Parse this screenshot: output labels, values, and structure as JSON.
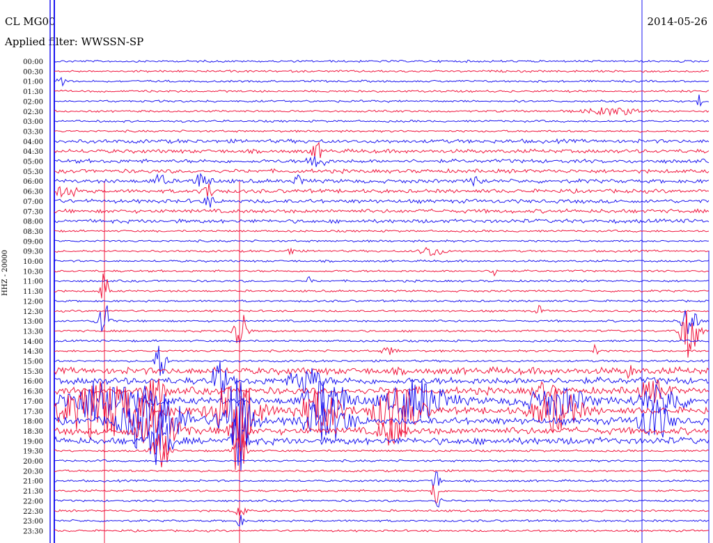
{
  "header": {
    "station": "CL MG00",
    "date": "2014-05-26",
    "filter": "Applied filter: WWSSN-SP"
  },
  "colors": {
    "trace_a": "#1a14f0",
    "trace_b": "#f0143c",
    "background": "#ffffff",
    "text": "#000000"
  },
  "chart_data": {
    "type": "line",
    "title": "",
    "ylabel": "HHZ - 20000",
    "xlabel": "",
    "row_labels": [
      "00:00",
      "00:30",
      "01:00",
      "01:30",
      "02:00",
      "02:30",
      "03:00",
      "03:30",
      "04:00",
      "04:30",
      "05:00",
      "05:30",
      "06:00",
      "06:30",
      "07:00",
      "07:30",
      "08:00",
      "08:30",
      "09:00",
      "09:30",
      "10:00",
      "10:30",
      "11:00",
      "11:30",
      "12:00",
      "12:30",
      "13:00",
      "13:30",
      "14:00",
      "14:30",
      "15:00",
      "15:30",
      "16:00",
      "16:30",
      "17:00",
      "17:30",
      "18:00",
      "18:30",
      "19:00",
      "19:30",
      "20:00",
      "20:30",
      "21:00",
      "21:30",
      "22:00",
      "22:30",
      "23:00",
      "23:30"
    ],
    "row_colors": [
      "blue",
      "red",
      "blue",
      "red",
      "blue",
      "red",
      "blue",
      "red",
      "blue",
      "red",
      "blue",
      "red",
      "blue",
      "red",
      "blue",
      "red",
      "blue",
      "red",
      "blue",
      "red",
      "blue",
      "red",
      "blue",
      "red",
      "blue",
      "red",
      "blue",
      "red",
      "blue",
      "red",
      "blue",
      "red",
      "blue",
      "red",
      "blue",
      "red",
      "blue",
      "red",
      "blue",
      "red",
      "blue",
      "red",
      "blue",
      "red",
      "blue",
      "red",
      "blue",
      "red"
    ],
    "grid": false,
    "legend": "none"
  }
}
